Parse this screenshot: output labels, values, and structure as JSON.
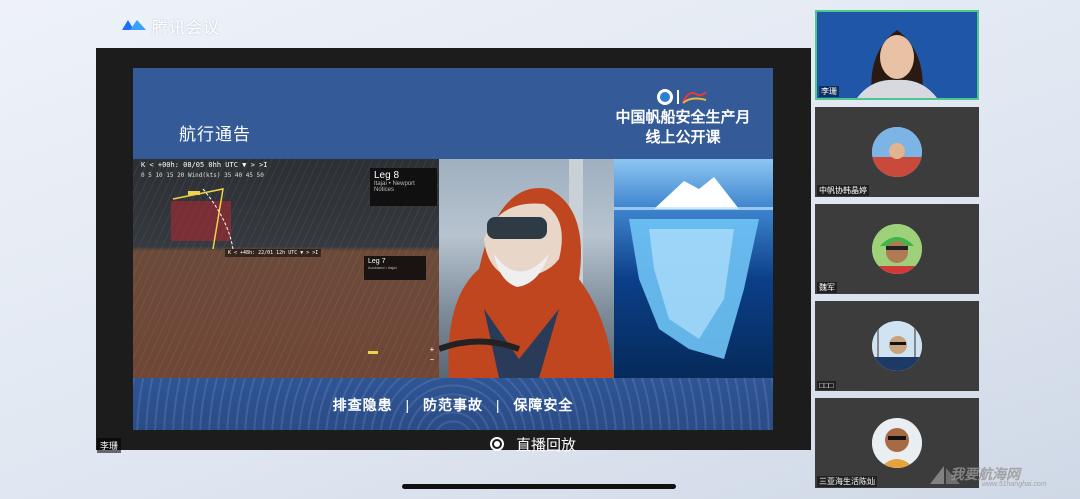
{
  "app": {
    "title": "腾讯会议",
    "brand_color": "#1e6fff"
  },
  "slide": {
    "heading": "航行通告",
    "event_title_line1": "中国帆船安全生产月",
    "event_title_line2": "线上公开课",
    "map": {
      "toolbar": "K < +00h: 08/05 0hh UTC ▼ > >I",
      "scale": "0  5  10  15  20 Wind(kts) 35  40  45  50",
      "leg_primary": {
        "name": "Leg 8",
        "route": "Itajaí • Newport",
        "note": "Notices"
      },
      "leg_secondary": {
        "name": "Leg 7",
        "route": "Auckland • Itajaí"
      },
      "toolbar_2": "K < +48h: 22/01 12h UTC ▼ > >I",
      "zoom_in": "+",
      "zoom_out": "−"
    },
    "footer_items": [
      "排查隐患",
      "防范事故",
      "保障安全"
    ],
    "footer_separator": "|"
  },
  "replay": {
    "label": "直播回放",
    "icon": "record-icon"
  },
  "speaker_label": "李珊",
  "participants": [
    {
      "name": "李珊",
      "active": true
    },
    {
      "name": "中帆协韩晶婷",
      "active": false
    },
    {
      "name": "魏军",
      "active": false
    },
    {
      "name": "□□□",
      "active": false
    },
    {
      "name": "三亚海生活陈灿",
      "active": false
    }
  ],
  "watermark": {
    "main": "我要航海网",
    "url": "www.51hanghai.com"
  }
}
